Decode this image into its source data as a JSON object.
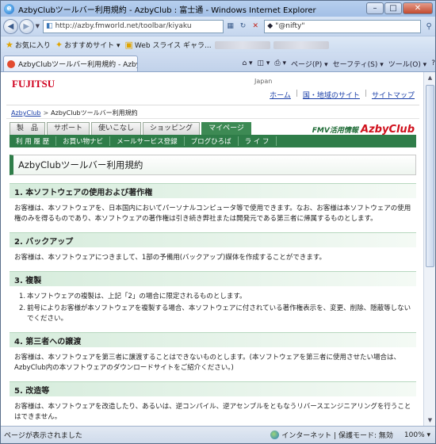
{
  "window": {
    "title": "AzbyClubツールバー利用規約 - AzbyClub : 富士通 - Windows Internet Explorer",
    "min_glyph": "–",
    "max_glyph": "□",
    "close_glyph": "✕"
  },
  "address": {
    "url": "http://azby.fmworld.net/toolbar/kiyaku",
    "search_value": "\"@nifty\""
  },
  "favorites": {
    "label": "お気に入り",
    "items": [
      "おすすめサイト ▾",
      "Web スライス ギャラ..."
    ]
  },
  "tab": {
    "label": "AzbyClubツールバー利用規約 - AzbyCl..."
  },
  "tab_tools": {
    "page": "ページ(P) ▾",
    "safety": "セーフティ(S) ▾",
    "tools": "ツール(O) ▾",
    "help": "?"
  },
  "header": {
    "logo": "FUJITSU",
    "region": "Japan",
    "links": [
      "ホーム",
      "国・地域のサイト",
      "サイトマップ"
    ]
  },
  "breadcrumb": {
    "home": "AzbyClub",
    "current": "AzbyClubツールバー利用規約"
  },
  "gnav": {
    "tabs": [
      "製　品",
      "サポート",
      "使いこなし",
      "ショッピング",
      "マイページ"
    ],
    "active_index": 4,
    "subnav": [
      "利 用 履 歴",
      "お買い物ナビ",
      "メールサービス登録",
      "ブログひろば",
      "ラ イ フ"
    ],
    "brand_prefix": "FMV活用情報",
    "brand": "AzbyClub"
  },
  "page_title": "AzbyClubツールバー利用規約",
  "sections": [
    {
      "heading": "1. 本ソフトウェアの使用および著作権",
      "body": "お客様は、本ソフトウェアを、日本国内においてパーソナルコンピュータ等で使用できます。なお、お客様は本ソフトウェアの使用権のみを得るものであり、本ソフトウェアの著作権は引き続き弊社または開発元である第三者に帰属するものとします。"
    },
    {
      "heading": "2. バックアップ",
      "body": "お客様は、本ソフトウェアにつきまして、1部の予備用(バックアップ)媒体を作成することができます。"
    },
    {
      "heading": "3. 複製",
      "items": [
        "本ソフトウェアの複製は、上記「2」の場合に限定されるものとします。",
        "前号によりお客様が本ソフトウェアを複製する場合、本ソフトウェアに付されている著作権表示を、変更、削除、隠蔽等しないでください。"
      ]
    },
    {
      "heading": "4. 第三者への譲渡",
      "body": "お客様は、本ソフトウェアを第三者に譲渡することはできないものとします。(本ソフトウェアを第三者に使用させたい場合は、AzbyClub内の本ソフトウェアのダウンロードサイトをご紹介ください。)"
    },
    {
      "heading": "5. 改造等",
      "body": "お客様は、本ソフトウェアを改造したり、あるいは、逆コンパイル、逆アセンブルをともなうリバースエンジニアリングを行うことはできません。"
    }
  ],
  "status": {
    "left": "ページが表示されました",
    "zone": "インターネット | 保護モード: 無効",
    "zoom": "100% ▾"
  }
}
